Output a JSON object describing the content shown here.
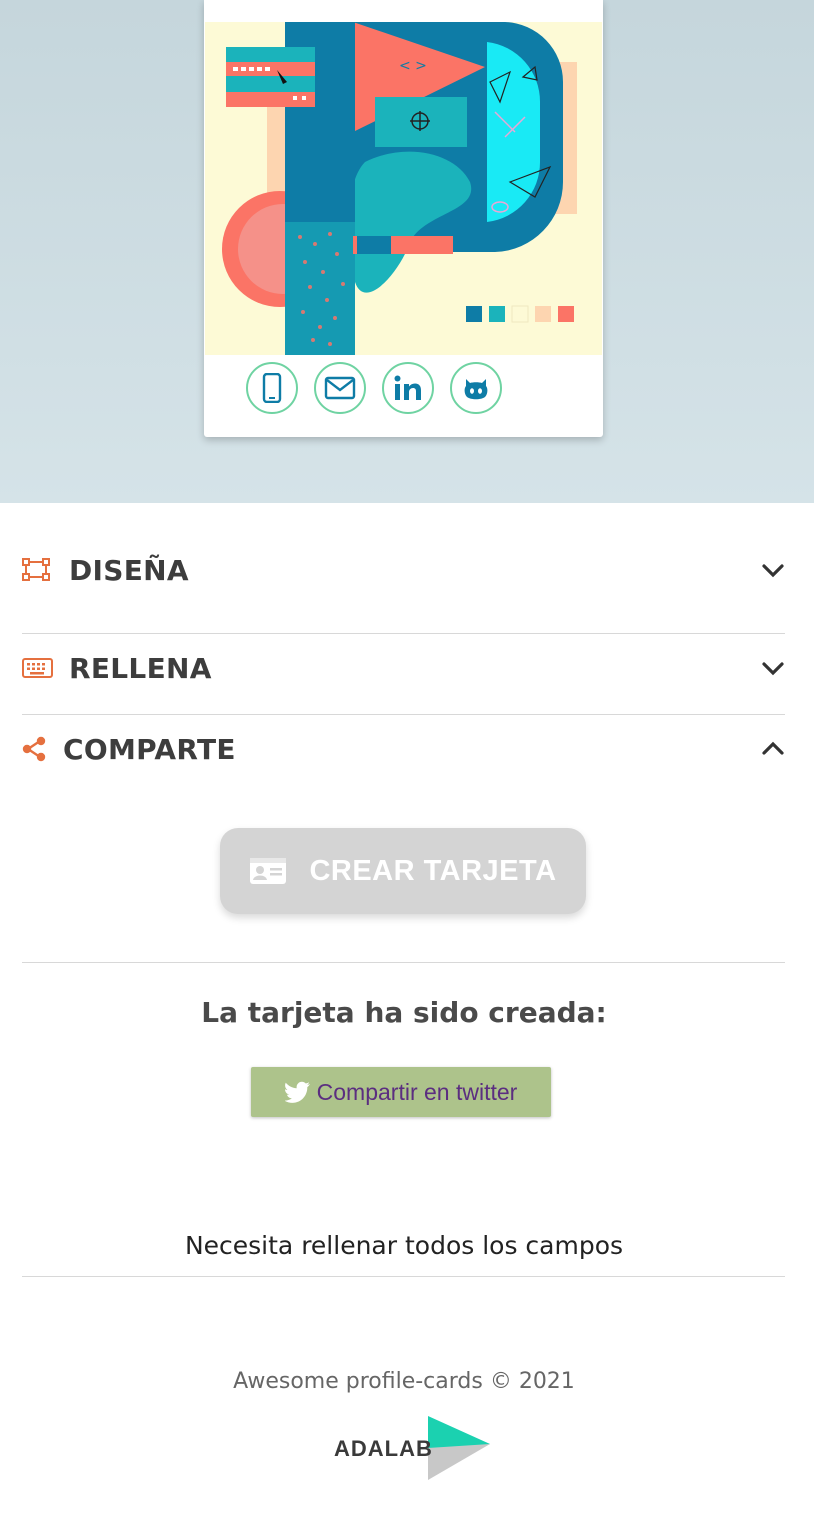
{
  "preview": {
    "social_icons": [
      "phone-icon",
      "email-icon",
      "linkedin-icon",
      "github-icon"
    ],
    "colors": {
      "teal": "#0e7ca6",
      "turquoise": "#1bb3bb",
      "coral": "#fb7466",
      "cream": "#fdfad6",
      "peach": "#fdd5b0",
      "accent_green": "#6fd3a2"
    }
  },
  "sections": {
    "design": {
      "title": "DISEÑA",
      "icon": "design-icon",
      "state": "collapsed"
    },
    "fill": {
      "title": "RELLENA",
      "icon": "keyboard-icon",
      "state": "collapsed"
    },
    "share": {
      "title": "COMPARTE",
      "icon": "share-icon",
      "state": "expanded"
    }
  },
  "share": {
    "create_button": "CREAR TARJETA",
    "created_message": "La tarjeta ha sido creada:",
    "twitter_button": "Compartir en twitter",
    "warning": "Necesita rellenar todos los campos"
  },
  "footer": {
    "copyright": "Awesome profile-cards © 2021",
    "logo_text": "ADALAB"
  },
  "accent": "#e5703f"
}
